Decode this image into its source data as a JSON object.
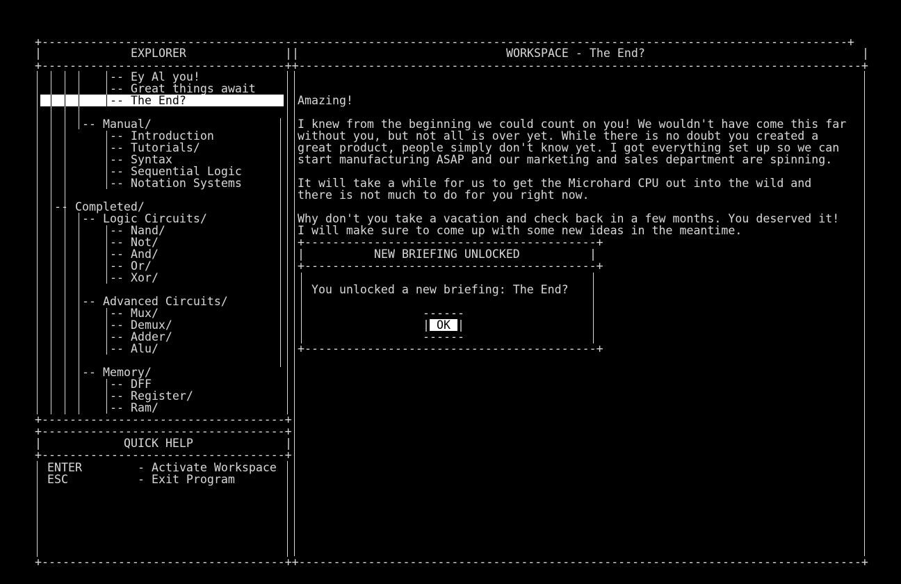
{
  "explorer": {
    "title": "EXPLORER",
    "items": [
      {
        "label": "-- Ey Al you!"
      },
      {
        "label": "-- Great things await"
      },
      {
        "label": "-- The End?",
        "selected": true
      },
      {
        "label": "-- Manual/"
      },
      {
        "label": "-- Introduction"
      },
      {
        "label": "-- Tutorials/"
      },
      {
        "label": "-- Syntax"
      },
      {
        "label": "-- Sequential Logic"
      },
      {
        "label": "-- Notation Systems"
      },
      {
        "label": "-- Completed/"
      },
      {
        "label": "-- Logic Circuits/"
      },
      {
        "label": "-- Nand/"
      },
      {
        "label": "-- Not/"
      },
      {
        "label": "-- And/"
      },
      {
        "label": "-- Or/"
      },
      {
        "label": "-- Xor/"
      },
      {
        "label": "-- Advanced Circuits/"
      },
      {
        "label": "-- Mux/"
      },
      {
        "label": "-- Demux/"
      },
      {
        "label": "-- Adder/"
      },
      {
        "label": "-- Alu/"
      },
      {
        "label": "-- Memory/"
      },
      {
        "label": "-- DFF"
      },
      {
        "label": "-- Register/"
      },
      {
        "label": "-- Ram/"
      }
    ]
  },
  "quick_help": {
    "title": "QUICK HELP",
    "rows": [
      {
        "key": "ENTER",
        "desc": "- Activate Workspace"
      },
      {
        "key": "ESC",
        "desc": "- Exit Program"
      }
    ]
  },
  "workspace": {
    "title": "WORKSPACE - The End?",
    "heading": "Amazing!",
    "lines": [
      "I knew from the beginning we could count on you! We wouldn't have come this far",
      "without you, but not all is over yet. While there is no doubt you created a",
      "great product, people simply don't know yet. I got everything set up so we can",
      "start manufacturing ASAP and our marketing and sales department are spinning.",
      "It will take a while for us to get the Microhard CPU out into the wild and",
      "there is not much to do for you right now.",
      "Why don't you take a vacation and check back in a few months. You deserved it!",
      "I will make sure to come up with some new ideas in the meantime."
    ]
  },
  "dialog": {
    "title": "NEW BRIEFING UNLOCKED",
    "message": "You unlocked a new briefing: The End?",
    "ok_label": "OK"
  },
  "colors": {
    "background": "#000000",
    "text": "#d8d8d8",
    "highlight": "#ffffff"
  }
}
